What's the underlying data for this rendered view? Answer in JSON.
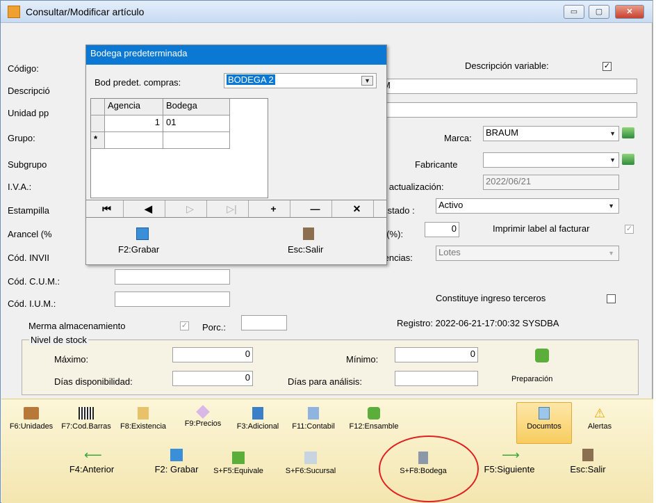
{
  "window": {
    "title": "Consultar/Modificar artículo",
    "min": "▭",
    "max": "▢",
    "close": "✕"
  },
  "form": {
    "codigo_label": "Código:",
    "descripcion_label": "Descripció",
    "descripcion_value": "M",
    "unidad_label": "Unidad pp",
    "grupo_label": "Grupo:",
    "subgrupo_label": "Subgrupo",
    "iva_label": "I.V.A.:",
    "estampilla_label": "Estampilla",
    "arancel_label": "Arancel (%",
    "cod_invima_label": "Cód. INVII",
    "cod_cum_label": "Cód. C.U.M.:",
    "cod_ium_label": "Cód. I.U.M.:",
    "desc_variable_label": "Descripción variable:",
    "desc_variable_checked": "✓",
    "marca_label": "Marca:",
    "marca_value": "BRAUM",
    "fabricante_label": "Fabricante",
    "fabricante_value": "",
    "fecha_label": "a actualización:",
    "fecha_value": "2022/06/21",
    "estado_label": "Estado :",
    "estado_value": "Activo",
    "desc_pct_label": "o(%):",
    "desc_pct_value": "0",
    "imprimir_label": "Imprimir label al facturar",
    "imprimir_checked": "✓",
    "existencias_label": "tencias:",
    "existencias_value": "Lotes",
    "constituye_label": "Constituye ingreso terceros",
    "merma_label": "Merma almacenamiento",
    "merma_checked": "✓",
    "porc_label": "Porc.:",
    "registro": "Registro: 2022-06-21-17:00:32 SYSDBA"
  },
  "stock": {
    "legend": "Nivel de stock",
    "maximo_label": "Máximo:",
    "maximo_value": "0",
    "minimo_label": "Mínimo:",
    "minimo_value": "0",
    "dias_disp_label": "Días disponibilidad:",
    "dias_disp_value": "0",
    "dias_analisis_label": "Días para análisis:",
    "dias_analisis_value": "",
    "preparacion_label": "Preparación"
  },
  "overlay": {
    "title": "Bodega predeterminada",
    "compras_label": "Bod predet. compras:",
    "compras_value": "BODEGA 2",
    "columns": [
      "Agencia",
      "Bodega"
    ],
    "rows": [
      {
        "agencia": "1",
        "bodega": "01"
      }
    ],
    "new_row_marker": "*",
    "nav": [
      "⏮",
      "◀",
      "▷",
      "▷|",
      "+",
      "—",
      "✕"
    ],
    "grabar_label": "F2:Grabar",
    "salir_label": "Esc:Salir"
  },
  "toolbar": {
    "row1": [
      "F6:Unidades",
      "F7:Cod.Barras",
      "F8:Existencia",
      "F9:Precios",
      "F3:Adicional",
      "F11:Contabil",
      "F12:Ensamble",
      "Documtos",
      "Alertas"
    ],
    "row2": [
      "F4:Anterior",
      "F2: Grabar",
      "S+F5:Equivale",
      "S+F6:Sucursal",
      "S+F8:Bodega",
      "F5:Siguiente",
      "Esc:Salir"
    ]
  },
  "colors": {
    "titlebar": "#c7dbf2",
    "overlay_title": "#0b78d4",
    "toolbar": "#f4e6b0",
    "highlight_circle": "#e02020"
  }
}
